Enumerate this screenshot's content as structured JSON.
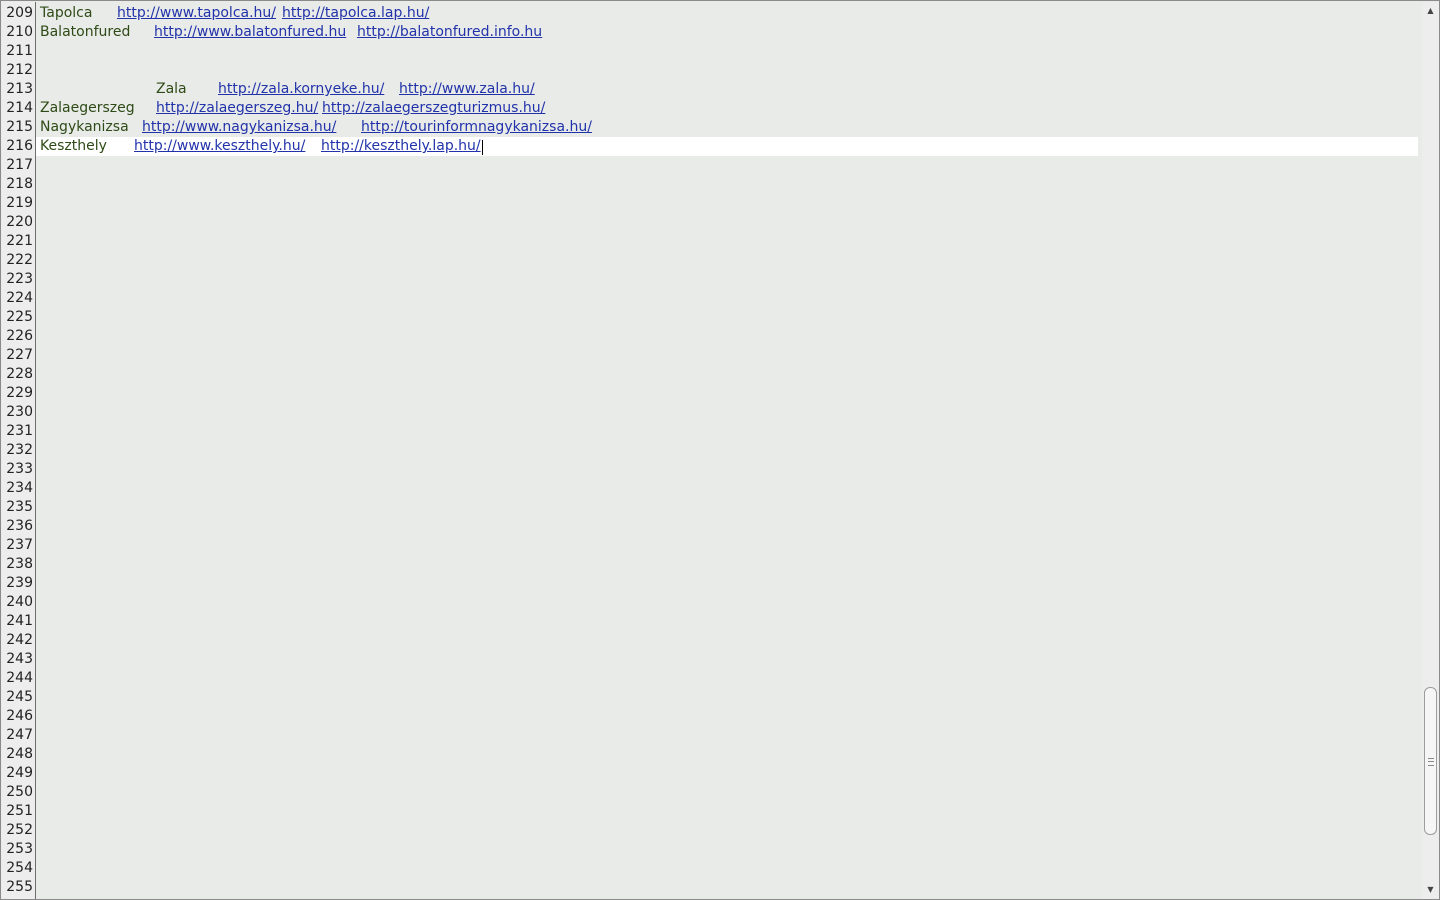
{
  "editor": {
    "line_numbers": [
      "209",
      "210",
      "211",
      "212",
      "213",
      "214",
      "215",
      "216",
      "217",
      "218",
      "219",
      "220",
      "221",
      "222",
      "223",
      "224",
      "225",
      "226",
      "227",
      "228",
      "229",
      "230",
      "231",
      "232",
      "233",
      "234",
      "235",
      "236",
      "237",
      "238",
      "239",
      "240",
      "241",
      "242",
      "243",
      "244",
      "245",
      "246",
      "247",
      "248",
      "249",
      "250",
      "251",
      "252",
      "253",
      "254",
      "255"
    ],
    "rows": {
      "r209": {
        "city": "Tapolca",
        "link1": "http://www.tapolca.hu/",
        "link2": "http://tapolca.lap.hu/"
      },
      "r210": {
        "city": "Balatonfured",
        "link1": "http://www.balatonfured.hu",
        "link2": "http://balatonfured.info.hu"
      },
      "r213": {
        "city": "Zala",
        "link1": "http://zala.kornyeke.hu/",
        "link2": "http://www.zala.hu/"
      },
      "r214": {
        "city": "Zalaegerszeg",
        "link1": "http://zalaegerszeg.hu/",
        "link2": "http://zalaegerszegturizmus.hu/"
      },
      "r215": {
        "city": "Nagykanizsa",
        "link1": "http://www.nagykanizsa.hu/",
        "link2": "http://tourinformnagykanizsa.hu/"
      },
      "r216": {
        "city": "Keszthely",
        "link1": "http://www.keszthely.hu/",
        "link2": "http://keszthely.lap.hu/"
      }
    },
    "current_line": "216"
  },
  "scrollbar": {
    "up_arrow_icon": "chevron-up-icon",
    "down_arrow_icon": "chevron-down-icon"
  },
  "colors": {
    "background": "#e9ebe9",
    "current_line": "#ffffff",
    "link": "#2233aa",
    "text": "#2e4a16"
  }
}
